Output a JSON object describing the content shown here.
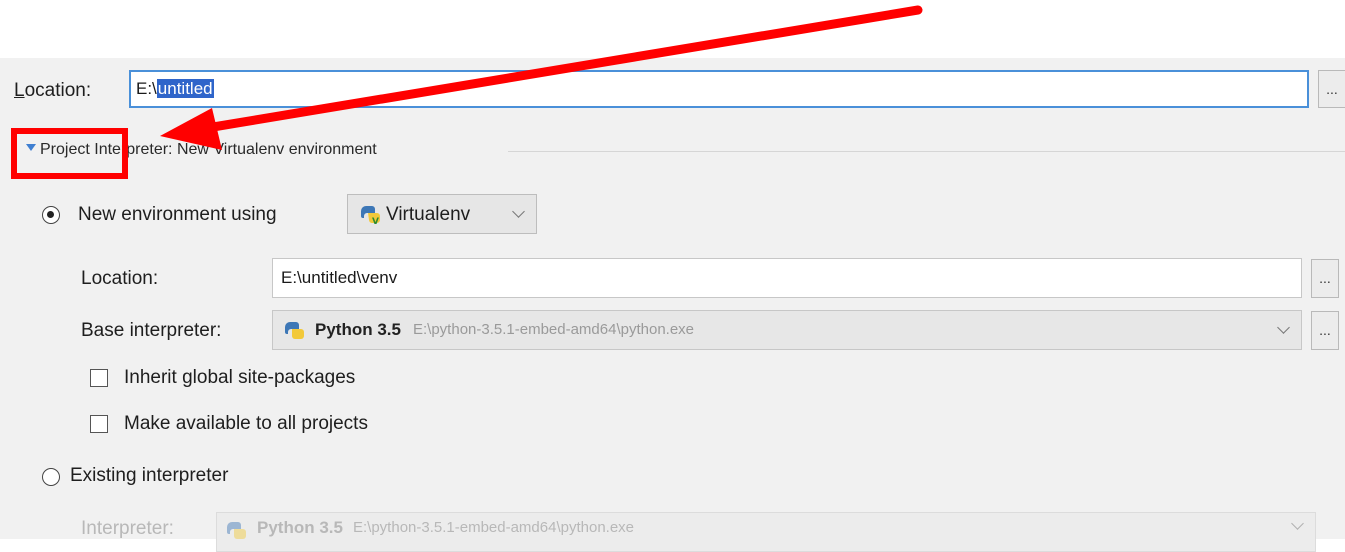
{
  "location": {
    "label_prefix": "",
    "label_mnemonic": "L",
    "label_rest": "ocation:",
    "value_prefix": "E:\\",
    "value_selected": "untitled",
    "browse_label": "..."
  },
  "interpreter_section": {
    "title": "Project Interpreter: New Virtualenv environment"
  },
  "new_env": {
    "radio_label": "New environment using",
    "selected": true,
    "tool": "Virtualenv",
    "location_label": "Location:",
    "location_value": "E:\\untitled\\venv",
    "base_label": "Base interpreter:",
    "base_name": "Python 3.5",
    "base_path": "E:\\python-3.5.1-embed-amd64\\python.exe",
    "browse_label": "...",
    "inherit_label": "Inherit global site-packages",
    "inherit_checked": false,
    "available_label": "Make available to all projects",
    "available_checked": false
  },
  "existing": {
    "radio_label": "Existing interpreter",
    "selected": false,
    "interpreter_label": "Interpreter:",
    "interpreter_name": "Python 3.5",
    "interpreter_path": "E:\\python-3.5.1-embed-amd64\\python.exe"
  },
  "annotation": {
    "color": "#ff0000"
  }
}
